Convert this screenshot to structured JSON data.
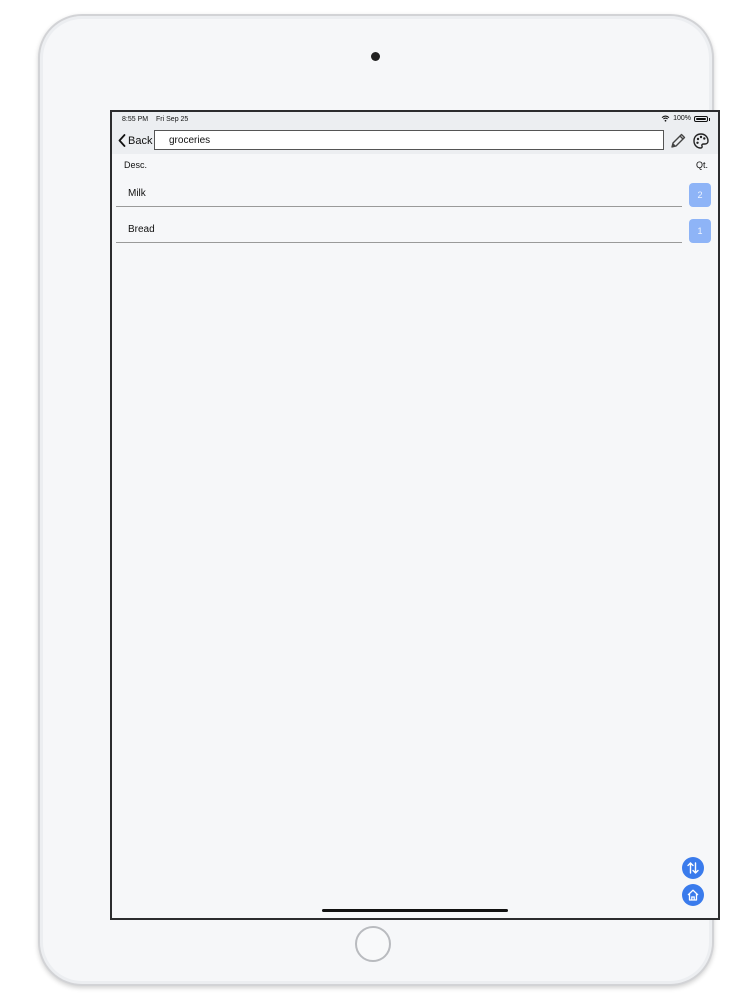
{
  "status_bar": {
    "time": "8:55 PM",
    "date": "Fri Sep 25",
    "battery": "100%"
  },
  "nav": {
    "back_label": "Back",
    "title_value": "groceries"
  },
  "columns": {
    "desc": "Desc.",
    "qty": "Qt."
  },
  "items": [
    {
      "label": "Milk",
      "qty": "2"
    },
    {
      "label": "Bread",
      "qty": "1"
    }
  ],
  "icons": [
    "wifi-icon",
    "battery-icon",
    "chevron-left-icon",
    "pencil-icon",
    "palette-icon",
    "sort-icon",
    "home-icon"
  ],
  "colors": {
    "accent": "#3a7bec",
    "qty_badge": "#8eb4f7",
    "background": "#f6f7f9"
  }
}
